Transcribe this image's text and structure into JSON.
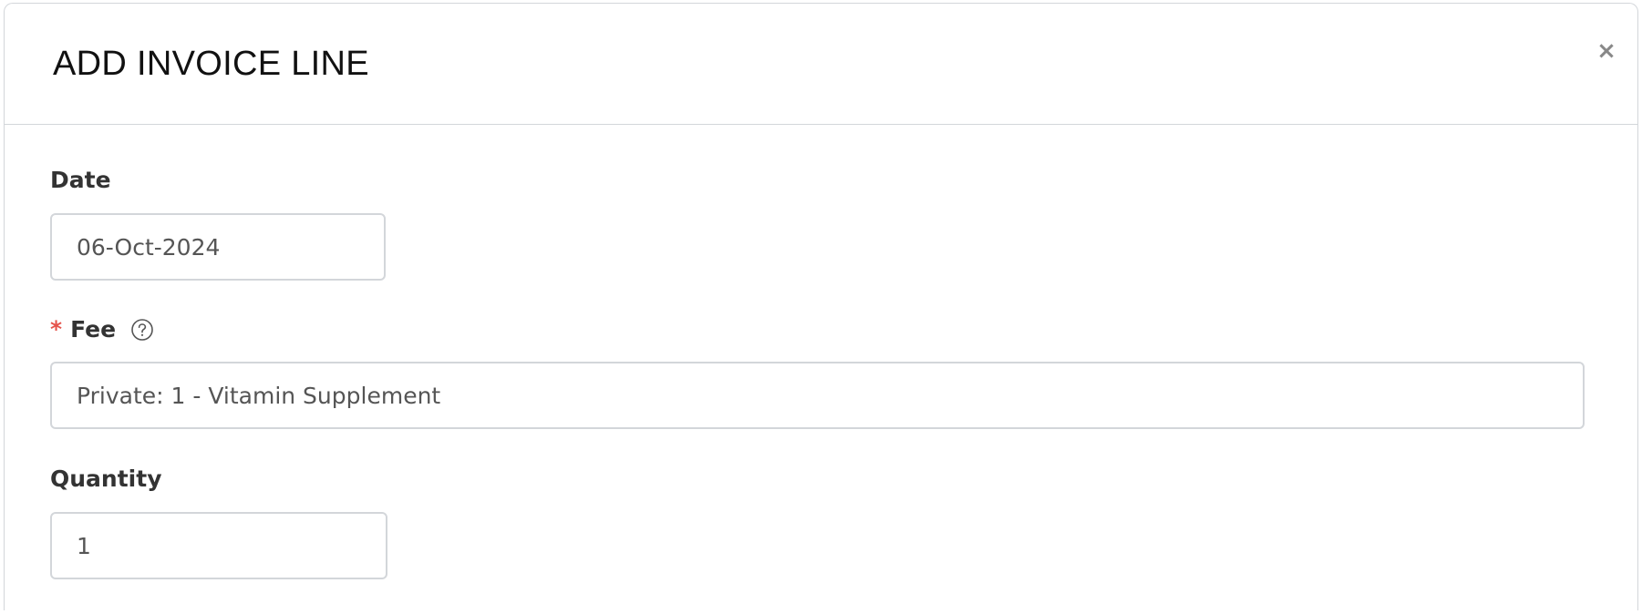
{
  "dialog": {
    "title": "ADD INVOICE LINE",
    "close_glyph": "×",
    "close_icon": "close-icon"
  },
  "form": {
    "date": {
      "label": "Date",
      "value": "06-Oct-2024"
    },
    "fee": {
      "required_marker": "*",
      "label": "Fee",
      "help_icon": "question-circle-icon",
      "value": "Private: 1 - Vitamin Supplement"
    },
    "quantity": {
      "label": "Quantity",
      "value": "1"
    }
  },
  "colors": {
    "required_marker": "#e5534b",
    "border": "#d3d6da",
    "title_text": "#111111",
    "label_text": "#333333",
    "input_text": "#555555",
    "close_icon": "#888888"
  }
}
